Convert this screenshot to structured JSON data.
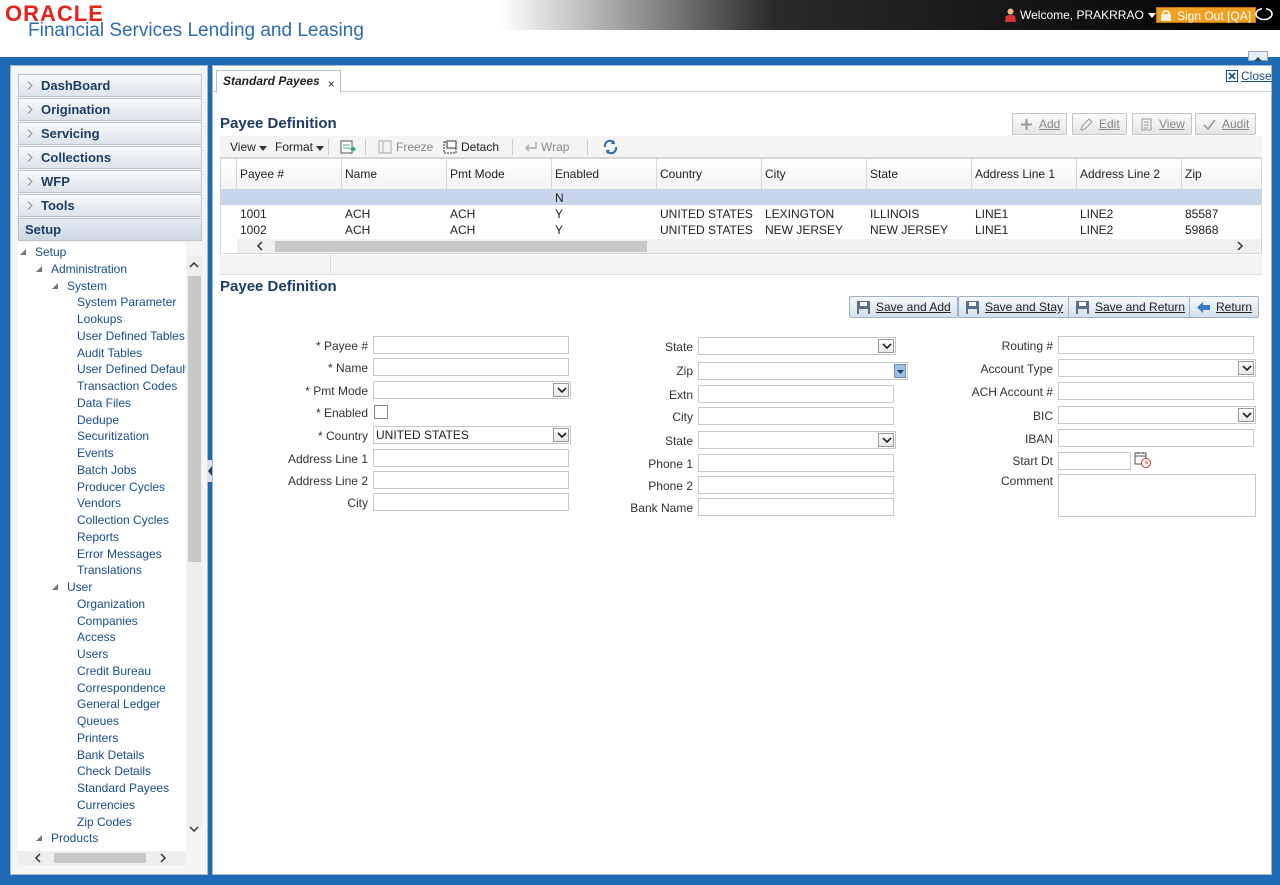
{
  "header": {
    "brand": "ORACLE",
    "product": "Financial Services Lending and Leasing",
    "welcome": "Welcome, PRAKRRAO",
    "signout": "Sign Out [QA]"
  },
  "sidebar": {
    "menus": [
      "DashBoard",
      "Origination",
      "Servicing",
      "Collections",
      "WFP",
      "Tools",
      "Setup"
    ],
    "tree": [
      {
        "label": "Setup",
        "level": 0,
        "expanded": true
      },
      {
        "label": "Administration",
        "level": 1,
        "expanded": true
      },
      {
        "label": "System",
        "level": 2,
        "expanded": true
      },
      {
        "label": "System Parameter",
        "level": 3
      },
      {
        "label": "Lookups",
        "level": 3
      },
      {
        "label": "User Defined Tables",
        "level": 3
      },
      {
        "label": "Audit Tables",
        "level": 3
      },
      {
        "label": "User Defined Default",
        "level": 3
      },
      {
        "label": "Transaction Codes",
        "level": 3
      },
      {
        "label": "Data Files",
        "level": 3
      },
      {
        "label": "Dedupe",
        "level": 3
      },
      {
        "label": "Securitization",
        "level": 3
      },
      {
        "label": "Events",
        "level": 3
      },
      {
        "label": "Batch Jobs",
        "level": 3
      },
      {
        "label": "Producer Cycles",
        "level": 3
      },
      {
        "label": "Vendors",
        "level": 3
      },
      {
        "label": "Collection Cycles",
        "level": 3
      },
      {
        "label": "Reports",
        "level": 3
      },
      {
        "label": "Error Messages",
        "level": 3
      },
      {
        "label": "Translations",
        "level": 3
      },
      {
        "label": "User",
        "level": 2,
        "expanded": true
      },
      {
        "label": "Organization",
        "level": 3
      },
      {
        "label": "Companies",
        "level": 3
      },
      {
        "label": "Access",
        "level": 3
      },
      {
        "label": "Users",
        "level": 3
      },
      {
        "label": "Credit Bureau",
        "level": 3
      },
      {
        "label": "Correspondence",
        "level": 3
      },
      {
        "label": "General Ledger",
        "level": 3
      },
      {
        "label": "Queues",
        "level": 3
      },
      {
        "label": "Printers",
        "level": 3
      },
      {
        "label": "Bank Details",
        "level": 3
      },
      {
        "label": "Check Details",
        "level": 3
      },
      {
        "label": "Standard Payees",
        "level": 3
      },
      {
        "label": "Currencies",
        "level": 3
      },
      {
        "label": "Zip Codes",
        "level": 3
      },
      {
        "label": "Products",
        "level": 1,
        "expanded": true
      }
    ]
  },
  "main": {
    "tab": "Standard Payees",
    "close": "Close",
    "section1_title": "Payee Definition",
    "toolbar": {
      "add": "Add",
      "edit": "Edit",
      "view": "View",
      "audit": "Audit"
    },
    "gridbar": {
      "view": "View",
      "format": "Format",
      "freeze": "Freeze",
      "detach": "Detach",
      "wrap": "Wrap"
    },
    "grid": {
      "columns": [
        "Payee #",
        "Name",
        "Pmt Mode",
        "Enabled",
        "Country",
        "City",
        "State",
        "Address Line 1",
        "Address Line 2",
        "Zip"
      ],
      "filter": [
        "",
        "",
        "",
        "N",
        "",
        "",
        "",
        "",
        "",
        ""
      ],
      "rows": [
        [
          "1001",
          "ACH",
          "ACH",
          "Y",
          "UNITED STATES",
          "LEXINGTON",
          "ILLINOIS",
          "LINE1",
          "LINE2",
          "85587"
        ],
        [
          "1002",
          "ACH",
          "ACH",
          "Y",
          "UNITED STATES",
          "NEW JERSEY",
          "NEW JERSEY",
          "LINE1",
          "LINE2",
          "59868"
        ]
      ]
    },
    "section2_title": "Payee Definition",
    "actions": {
      "save_add": "Save and Add",
      "save_stay": "Save and Stay",
      "save_return": "Save and Return",
      "return": "Return"
    },
    "form": {
      "col1": {
        "payee": "* Payee #",
        "name": "* Name",
        "pmt_mode": "* Pmt Mode",
        "enabled": "* Enabled",
        "country": "* Country",
        "country_value": "UNITED STATES",
        "addr1": "Address Line 1",
        "addr2": "Address Line 2",
        "city": "City"
      },
      "col2": {
        "state1": "State",
        "zip": "Zip",
        "extn": "Extn",
        "city": "City",
        "state2": "State",
        "phone1": "Phone 1",
        "phone2": "Phone 2",
        "bank_name": "Bank Name"
      },
      "col3": {
        "routing": "Routing #",
        "account_type": "Account Type",
        "ach_account": "ACH Account #",
        "bic": "BIC",
        "iban": "IBAN",
        "start_dt": "Start Dt",
        "comment": "Comment"
      }
    }
  }
}
